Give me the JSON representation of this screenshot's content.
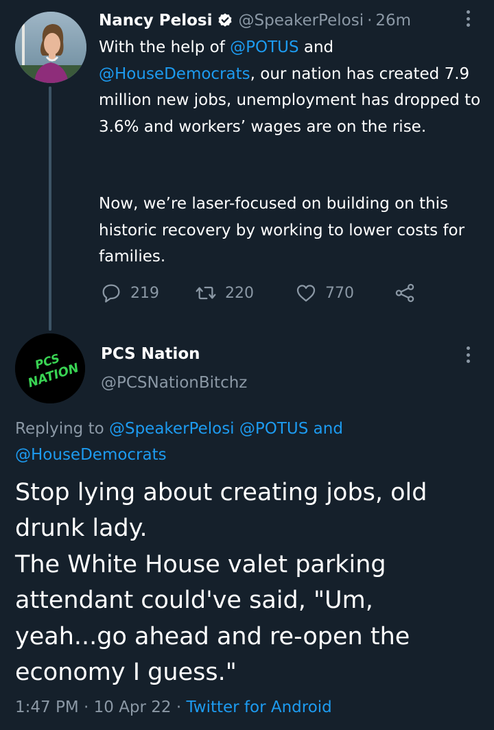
{
  "parent_tweet": {
    "author_name": "Nancy Pelosi",
    "verified": true,
    "handle": "@SpeakerPelosi",
    "separator": "·",
    "time_ago": "26m",
    "text_segments": {
      "p1_a": "With the help of ",
      "p1_mention1": "@POTUS",
      "p1_b": " and ",
      "p1_mention2": "@HouseDemocrats",
      "p1_c": ", our nation has created 7.9 million new jobs, unemployment has dropped to 3.6% and workers’ wages are on the rise.",
      "p2": "Now, we’re laser-focused on building on this historic recovery by working to lower costs for families."
    },
    "actions": {
      "replies": "219",
      "retweets": "220",
      "likes": "770"
    },
    "icons": {
      "reply": "comment-icon",
      "retweet": "retweet-icon",
      "like": "heart-icon",
      "share": "share-icon",
      "more": "more-vertical-icon",
      "verified": "verified-badge-icon"
    }
  },
  "reply_tweet": {
    "author_name": "PCS Nation",
    "handle": "@PCSNationBitchz",
    "avatar_text": [
      "PCS",
      "NATION"
    ],
    "avatar_text_color": "#39d353",
    "replying_to": {
      "prefix": "Replying to ",
      "mention1": "@SpeakerPelosi",
      "space": " ",
      "mention2": "@POTUS",
      "and": " and ",
      "mention3": "@HouseDemocrats"
    },
    "body_lines": [
      "Stop lying about creating jobs, old drunk lady.",
      "The White House valet parking attendant could've said, \"Um, yeah...go ahead and re-open the economy I guess.\""
    ],
    "meta": {
      "time": "1:47 PM",
      "sep1": " · ",
      "date": "10 Apr 22",
      "sep2": " · ",
      "source": "Twitter for Android"
    }
  },
  "colors": {
    "background": "#15202b",
    "text": "#ffffff",
    "muted": "#8b98a5",
    "link": "#1d9bf0",
    "thread_line": "#3d5466"
  }
}
